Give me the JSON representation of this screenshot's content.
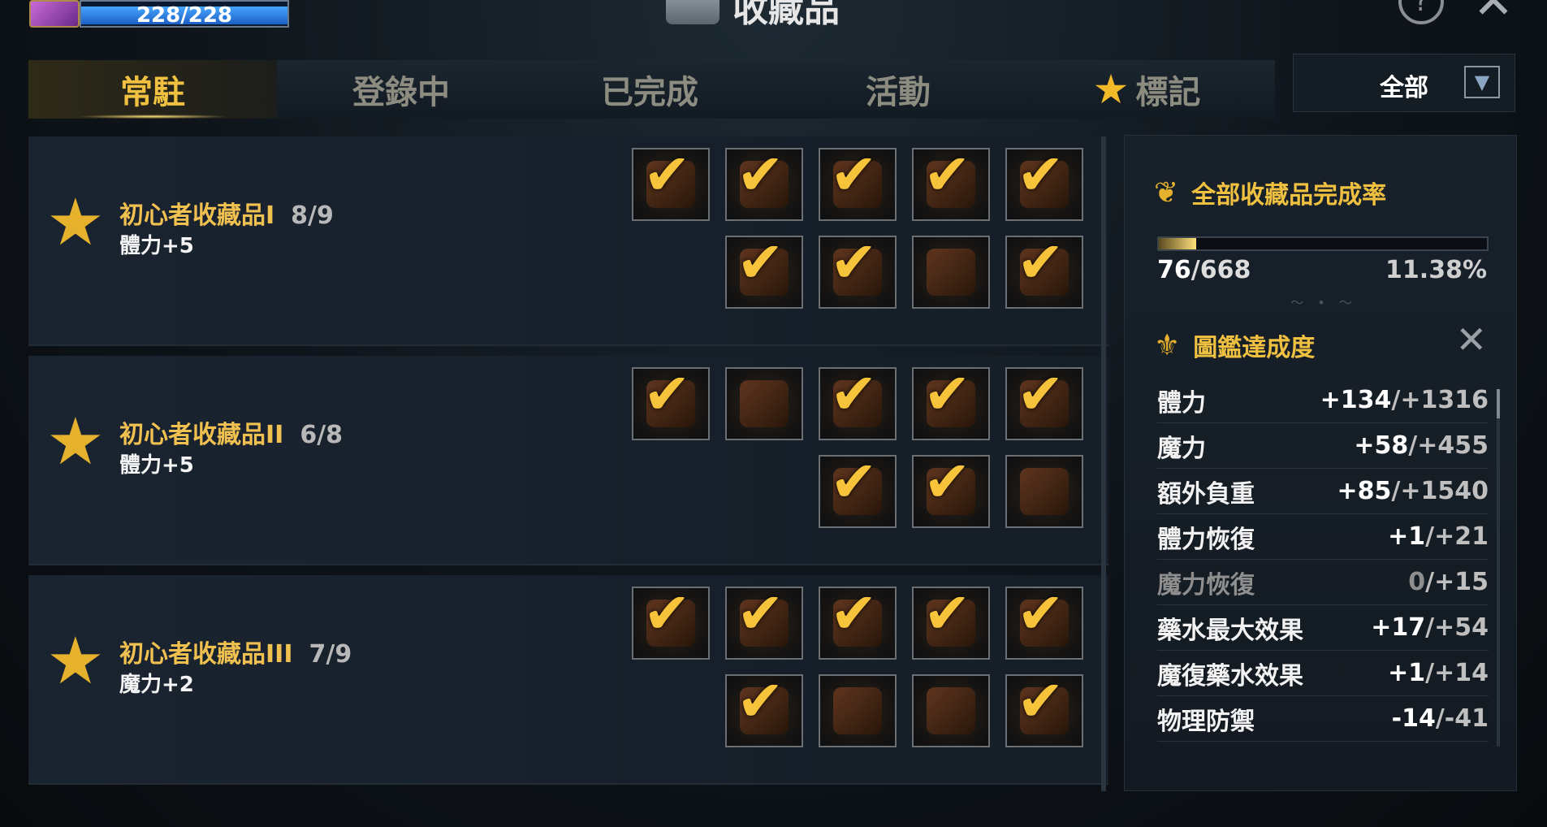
{
  "topbar": {
    "hp": "228/228",
    "title": "收藏品"
  },
  "tabs": [
    {
      "label": "常駐",
      "active": true
    },
    {
      "label": "登錄中",
      "active": false
    },
    {
      "label": "已完成",
      "active": false
    },
    {
      "label": "活動",
      "active": false
    },
    {
      "label": "標記",
      "active": false,
      "icon": "star-icon"
    }
  ],
  "filter": {
    "value": "全部"
  },
  "collections": [
    {
      "name": "初心者收藏品I",
      "count": "8/9",
      "bonus": "體力+5"
    },
    {
      "name": "初心者收藏品II",
      "count": "6/8",
      "bonus": "體力+5"
    },
    {
      "name": "初心者收藏品III",
      "count": "7/9",
      "bonus": "魔力+2"
    }
  ],
  "panel": {
    "completion_title": "全部收藏品完成率",
    "completion_current": "76",
    "completion_total": "/668",
    "completion_percent": "11.38%",
    "completion_fraction": 0.1138,
    "codex_title": "圖鑑達成度",
    "stats": [
      {
        "key": "體力",
        "cur": "+134",
        "total": "/+1316",
        "dim": false
      },
      {
        "key": "魔力",
        "cur": "+58",
        "total": "/+455",
        "dim": false
      },
      {
        "key": "額外負重",
        "cur": "+85",
        "total": "/+1540",
        "dim": false
      },
      {
        "key": "體力恢復",
        "cur": "+1",
        "total": "/+21",
        "dim": false
      },
      {
        "key": "魔力恢復",
        "cur": "0",
        "total": "/+15",
        "dim": true
      },
      {
        "key": "藥水最大效果",
        "cur": "+17",
        "total": "/+54",
        "dim": false
      },
      {
        "key": "魔復藥水效果",
        "cur": "+1",
        "total": "/+14",
        "dim": false
      },
      {
        "key": "物理防禦",
        "cur": "-14",
        "total": "/-41",
        "dim": false
      }
    ]
  },
  "colors": {
    "accent_gold": "#f0c040",
    "hp_blue": "#1b5fc4"
  }
}
